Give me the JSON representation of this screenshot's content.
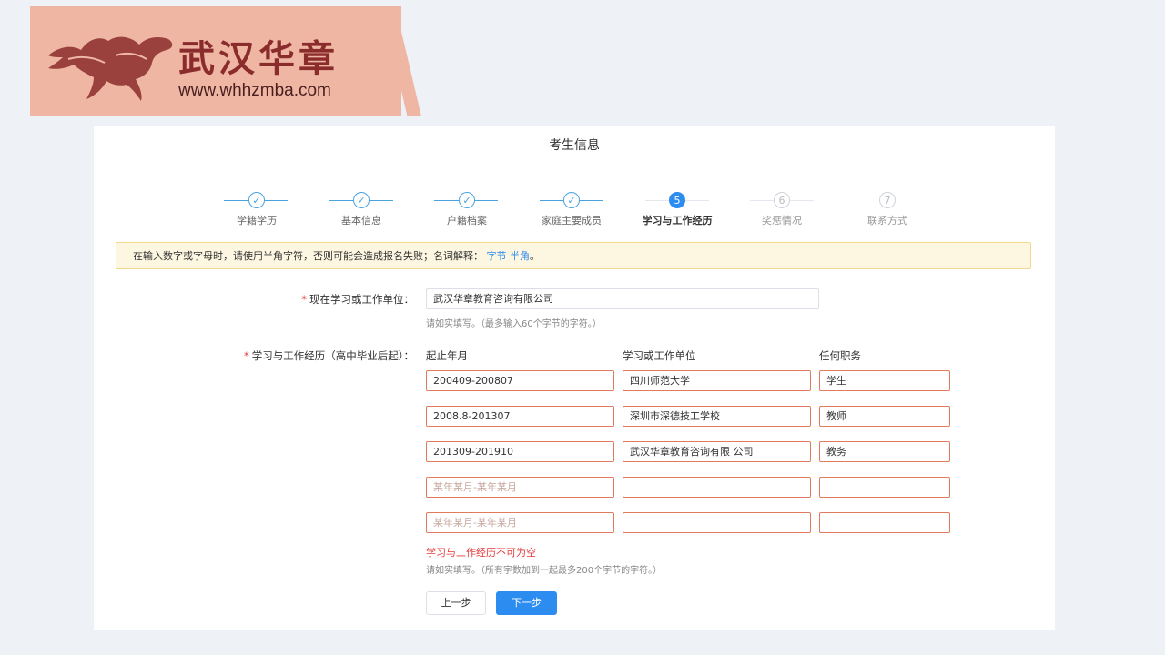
{
  "brand": {
    "name": "武汉华章",
    "url": "www.whhzmba.com"
  },
  "page": {
    "title": "考生信息"
  },
  "steps": [
    {
      "label": "学籍学历",
      "state": "done",
      "mark": "✓"
    },
    {
      "label": "基本信息",
      "state": "done",
      "mark": "✓"
    },
    {
      "label": "户籍档案",
      "state": "done",
      "mark": "✓"
    },
    {
      "label": "家庭主要成员",
      "state": "done",
      "mark": "✓"
    },
    {
      "label": "学习与工作经历",
      "state": "active",
      "mark": "5"
    },
    {
      "label": "奖惩情况",
      "state": "pending",
      "mark": "6"
    },
    {
      "label": "联系方式",
      "state": "pending",
      "mark": "7"
    }
  ],
  "notice": {
    "text": "在输入数字或字母时，请使用半角字符，否则可能会造成报名失败；名词解释：",
    "link1": "字节",
    "link2": "半角",
    "end": "。"
  },
  "form": {
    "current_unit": {
      "label": "现在学习或工作单位：",
      "value": "武汉华章教育咨询有限公司",
      "hint": "请如实填写。（最多输入60个字节的字符。）"
    },
    "history": {
      "label": "学习与工作经历（高中毕业后起）：",
      "columns": {
        "period": "起止年月",
        "unit": "学习或工作单位",
        "position": "任何职务"
      },
      "rows": [
        {
          "period": "200409-200807",
          "unit": "四川师范大学",
          "position": "学生"
        },
        {
          "period": "2008.8-201307",
          "unit": "深圳市深德技工学校",
          "position": "教师"
        },
        {
          "period": "201309-201910",
          "unit": "武汉华章教育咨询有限 公司",
          "position": "教务"
        },
        {
          "period": "",
          "unit": "",
          "position": ""
        },
        {
          "period": "",
          "unit": "",
          "position": ""
        }
      ],
      "period_placeholder": "某年某月-某年某月",
      "error": "学习与工作经历不可为空",
      "hint": "请如实填写。（所有字数加到一起最多200个字节的字符。）"
    }
  },
  "buttons": {
    "prev": "上一步",
    "next": "下一步"
  },
  "colors": {
    "accent": "#2d8cf0",
    "banner": "#efb6a4",
    "brand": "#8b2c2c",
    "error": "#e4393c"
  }
}
